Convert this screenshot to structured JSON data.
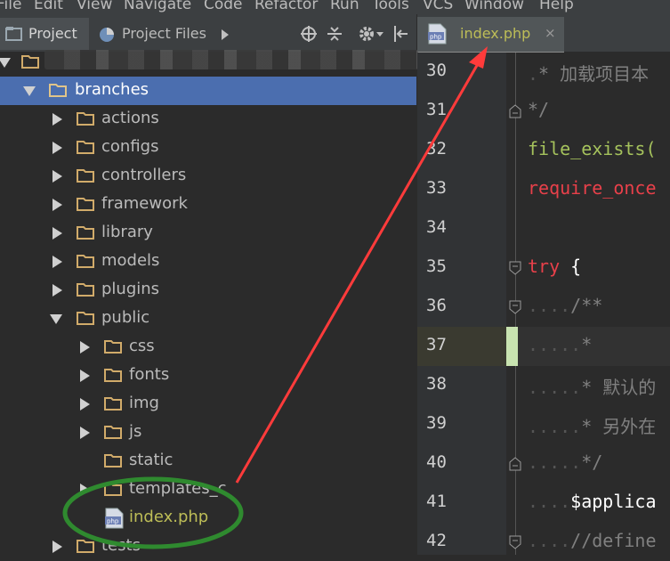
{
  "menu": [
    "File",
    "Edit",
    "View",
    "Navigate",
    "Code",
    "Refactor",
    "Run",
    "Tools",
    "VCS",
    "Window",
    "Help"
  ],
  "tool_tabs": {
    "project": "Project",
    "project_files": "Project Files"
  },
  "editor_tab": {
    "filename": "index.php",
    "close": "×"
  },
  "tree": {
    "branches": "branches",
    "children": [
      "actions",
      "configs",
      "controllers",
      "framework",
      "library",
      "models",
      "plugins",
      "public"
    ],
    "public_children": [
      "css",
      "fonts",
      "img",
      "js",
      "static",
      "templates_c"
    ],
    "file": "index.php",
    "last": "tests"
  },
  "code_lines": [
    {
      "n": "30",
      "text": "* 加载项目本"
    },
    {
      "n": "31",
      "text": "*/"
    },
    {
      "n": "32",
      "text": "file_exists("
    },
    {
      "n": "33",
      "text": "require_once"
    },
    {
      "n": "34",
      "text": ""
    },
    {
      "n": "35",
      "text_kw": "try",
      "text_rest": " {"
    },
    {
      "n": "36",
      "text": "/**"
    },
    {
      "n": "37",
      "text": "*"
    },
    {
      "n": "38",
      "text": "* 默认的"
    },
    {
      "n": "39",
      "text": "* 另外在"
    },
    {
      "n": "40",
      "text": "*/"
    },
    {
      "n": "41",
      "text": "$applica"
    },
    {
      "n": "42",
      "text": "//define"
    }
  ],
  "colors": {
    "selection": "#4b6eaf",
    "arrow": "#ff3b3b",
    "circle": "#2f8a2f",
    "php_file": "#bdbd57"
  }
}
